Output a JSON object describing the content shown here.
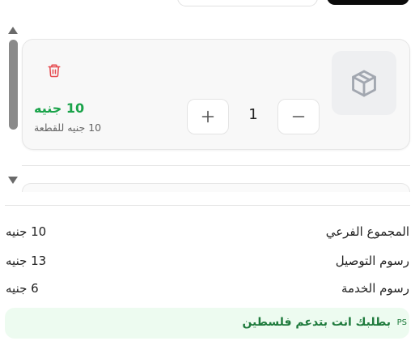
{
  "cart_item": {
    "price": "10 جنيه",
    "unit_price": "10 جنيه للقطعة",
    "quantity": "1",
    "image_icon": "package-icon",
    "delete_icon": "trash-icon"
  },
  "summary": {
    "rows": [
      {
        "label": "المجموع الفرعي",
        "value": "10 جنيه"
      },
      {
        "label": "رسوم التوصيل",
        "value": "13 جنيه"
      },
      {
        "label": "رسوم الخدمة",
        "value": "6 جنيه"
      }
    ]
  },
  "promo": {
    "tag": "PS",
    "text": "بطلبك انت بتدعم فلسطين"
  },
  "colors": {
    "price_green": "#1aa34a",
    "delete_red": "#e5484d",
    "promo_bg": "#edfbf0",
    "promo_text": "#1e7a3c"
  }
}
